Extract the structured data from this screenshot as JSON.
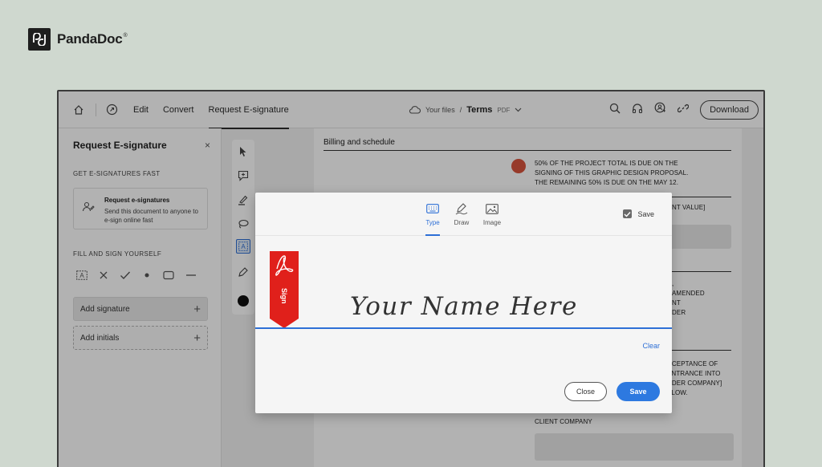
{
  "brand": {
    "name": "PandaDoc",
    "mark": "®"
  },
  "topbar": {
    "menu": [
      "Edit",
      "Convert",
      "Request E-signature"
    ],
    "active_menu": "Request E-signature",
    "breadcrumb": {
      "location": "Your files",
      "file_name": "Terms",
      "file_type": "PDF"
    },
    "download_label": "Download"
  },
  "left_panel": {
    "title": "Request E-signature",
    "close_glyph": "×",
    "section_fast": "GET E-SIGNATURES FAST",
    "card": {
      "title": "Request e-signatures",
      "description": "Send this document to anyone to e-sign online fast"
    },
    "section_fill": "FILL AND SIGN YOURSELF",
    "fill_tools": [
      "text-field-icon",
      "cross-icon",
      "check-icon",
      "dot-icon",
      "rectangle-icon",
      "line-icon"
    ],
    "add_signature_label": "Add signature",
    "add_initials_label": "Add initials",
    "plus_glyph": "+"
  },
  "toolbar": [
    "cursor-icon",
    "comment-icon",
    "highlight-pen-icon",
    "lasso-icon",
    "text-box-icon",
    "sign-pen-icon",
    "color-swatch-icon"
  ],
  "document": {
    "heading": "Billing and schedule",
    "para1": [
      "50% OF THE PROJECT TOTAL IS DUE ON THE",
      "SIGNING OF THIS GRAPHIC DESIGN PROPOSAL.",
      "THE REMAINING 50% IS DUE ON THE MAY 12."
    ],
    "frag_value": "NT VALUE]",
    "para2": [
      ",",
      "AMENDED",
      "NT",
      "DER"
    ],
    "para3": [
      "CCEPTANCE OF",
      "ENTRANCE INTO",
      "NDER COMPANY]",
      "ELOW."
    ],
    "client_company": "CLIENT COMPANY"
  },
  "modal": {
    "tabs": [
      {
        "label": "Type",
        "icon": "keyboard-icon"
      },
      {
        "label": "Draw",
        "icon": "pen-draw-icon"
      },
      {
        "label": "Image",
        "icon": "image-icon"
      }
    ],
    "active_tab": "Type",
    "save_checkbox_label": "Save",
    "save_checked": true,
    "ribbon_text": "Sign",
    "signature_text": "Your Name Here",
    "clear_label": "Clear",
    "close_label": "Close",
    "save_label": "Save"
  },
  "colors": {
    "accent": "#2d79e0",
    "ribbon_red": "#e0201b",
    "status_dot": "#d9533d"
  }
}
